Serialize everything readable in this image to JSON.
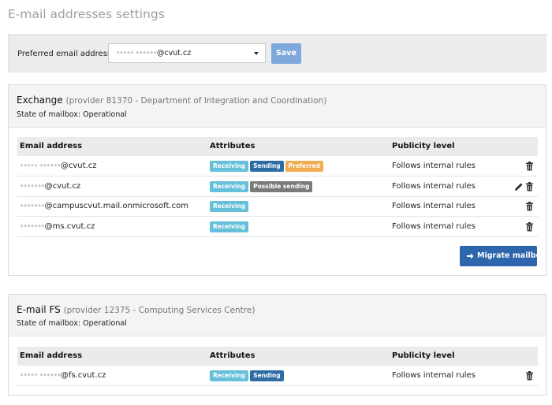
{
  "page": {
    "title": "E-mail addresses settings"
  },
  "preferred": {
    "label": "Preferred email address:",
    "selected_local": "••••• ••••••",
    "selected_domain": "@cvut.cz",
    "save_label": "Save",
    "save_color": "#7fa9dc"
  },
  "columns": {
    "email": "Email address",
    "attributes": "Attributes",
    "publicity": "Publicity level"
  },
  "exchange": {
    "name": "Exchange",
    "provider": "(provider 81370 - Department of Integration and Coordination)",
    "state": "State of mailbox: Operational",
    "rows": [
      {
        "local": "••••• ••••••",
        "domain": "@cvut.cz",
        "badges": [
          "Receiving",
          "Sending",
          "Preferred"
        ],
        "publicity": "Follows internal rules",
        "icons": [
          "trash-icon"
        ]
      },
      {
        "local": "•••••••",
        "domain": "@cvut.cz",
        "badges": [
          "Receiving",
          "Possible sending"
        ],
        "publicity": "Follows internal rules",
        "icons": [
          "pencil-icon",
          "trash-icon"
        ]
      },
      {
        "local": "•••••••",
        "domain": "@campuscvut.mail.onmicrosoft.com",
        "badges": [
          "Receiving"
        ],
        "publicity": "Follows internal rules",
        "icons": [
          "trash-icon"
        ]
      },
      {
        "local": "•••••••",
        "domain": "@ms.cvut.cz",
        "badges": [
          "Receiving"
        ],
        "publicity": "Follows internal rules",
        "icons": [
          "trash-icon"
        ]
      }
    ],
    "migrate_label": "Migrate mailbox",
    "migrate_color": "#2e66ad"
  },
  "emailfs": {
    "name": "E-mail FS",
    "provider": "(provider 12375 - Computing Services Centre)",
    "state": "State of mailbox: Operational",
    "rows": [
      {
        "local": "••••• ••••••",
        "domain": "@fs.cvut.cz",
        "badges": [
          "Receiving",
          "Sending"
        ],
        "publicity": "Follows internal rules",
        "icons": [
          "trash-icon"
        ]
      }
    ]
  },
  "badge_colors": {
    "Receiving": "#66c0da",
    "Sending": "#2e6ca6",
    "Preferred": "#efae52",
    "Possible sending": "#7a7a7a"
  }
}
